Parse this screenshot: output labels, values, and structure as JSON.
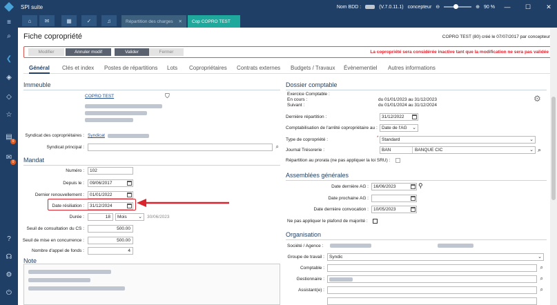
{
  "app": {
    "title": "SPI suite"
  },
  "titlebar": {
    "bdd_label": "Nom BDD :",
    "version": "(V.7.0.11.1)",
    "user": "concepteur",
    "zoom": "90 %",
    "minimize": "—",
    "maximize": "☐",
    "close": "✕"
  },
  "tabs": [
    {
      "label": "Répartition des charges",
      "close": "✕"
    },
    {
      "label": "Cop COPRO TEST"
    }
  ],
  "page": {
    "title": "Fiche copropriété",
    "created": "COPRO TEST (80) créé le 07/07/2017 par concepteur"
  },
  "actions": {
    "modifier": "Modifier",
    "annuler": "Annuler modif",
    "valider": "Valider",
    "fermer": "Fermer",
    "warning": "La copropriété sera considérée inactive tant que la modification ne sera pas validée"
  },
  "navtabs": [
    "Général",
    "Clés et index",
    "Postes de répartitions",
    "Lots",
    "Copropriétaires",
    "Contrats externes",
    "Budgets / Travaux",
    "Évènementiel",
    "Autres informations"
  ],
  "immeuble": {
    "title": "Immeuble",
    "name": "COPRO TEST",
    "syndicat_label": "Syndicat des copropriétaires :",
    "syndicat_value": "Syndicat",
    "principal_label": "Syndicat principal :",
    "principal_value": ""
  },
  "mandat": {
    "title": "Mandat",
    "numero_label": "Numéro :",
    "numero": "102",
    "depuis_label": "Depuis le :",
    "depuis": "09/06/2017",
    "dernier_label": "Dernier renouvellement :",
    "dernier": "01/01/2022",
    "resiliation_label": "Date résiliation :",
    "resiliation": "31/12/2024",
    "duree_label": "Durée :",
    "duree": "18",
    "duree_unit": "Mois",
    "duree_end": "30/06/2023",
    "seuil_cs_label": "Seuil de consultation du CS :",
    "seuil_cs": "500.00",
    "seuil_mc_label": "Seuil de mise en concurrence :",
    "seuil_mc": "500.00",
    "nb_appel_label": "Nombre d'appel de fonds :",
    "nb_appel": "4"
  },
  "note": {
    "title": "Note"
  },
  "dossier": {
    "title": "Dossier comptable",
    "exercice_label": "Exercice Comptable :",
    "encours_label": "En cours :",
    "encours": "du 01/01/2023 au 31/12/2023",
    "suivant_label": "Suivant :",
    "suivant": "du 01/01/2024 au 31/12/2024",
    "derniere_rep_label": "Dernière répartition :",
    "derniere_rep": "31/12/2022",
    "compta_label": "Comptabilisation de l'arrêté copropriétaire au :",
    "compta": "Date de l'AG",
    "type_label": "Type de copropriété :",
    "type": "Standard",
    "journal_label": "Journal Trésorerie :",
    "journal_code": "BAN",
    "journal_name": "BANQUE CIC",
    "prorata_label": "Répartition au prorata (ne pas appliquer la loi SRU) :"
  },
  "ag": {
    "title": "Assemblées générales",
    "derniere_label": "Date dernière AG :",
    "derniere": "16/06/2023",
    "prochaine_label": "Date prochaine AG :",
    "prochaine": "",
    "convocation_label": "Date dernière convocation :",
    "convocation": "10/05/2023",
    "plafond_label": "Ne pas appliquer le plafond de majorité :"
  },
  "organisation": {
    "title": "Organisation",
    "societe_label": "Société / Agence :",
    "groupe_label": "Groupe de travail :",
    "groupe": "Syndic",
    "comptable_label": "Comptable :",
    "gestionnaire_label": "Gestionnaire :",
    "assistant_label": "Assistant(e) :"
  },
  "colors": {
    "primary": "#1f3f66",
    "accent": "#1fa89c",
    "warning": "#d9232d"
  }
}
